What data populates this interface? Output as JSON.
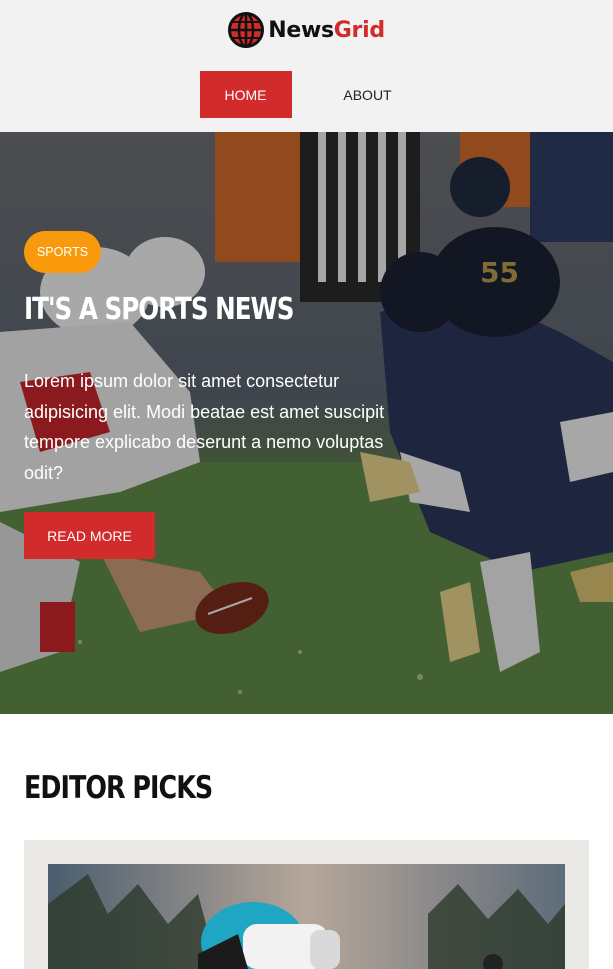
{
  "brand": {
    "name_part1": "News",
    "name_part2": "Grid",
    "accent_color": "#d22b2b",
    "logo_icon": "globe-icon"
  },
  "nav": {
    "items": [
      {
        "label": "HOME",
        "active": true
      },
      {
        "label": "ABOUT",
        "active": false
      }
    ]
  },
  "hero": {
    "category": "SPORTS",
    "title": "IT'S A SPORTS NEWS",
    "excerpt": "Lorem ipsum dolor sit amet consectetur adipisicing elit. Modi beatae est amet suscipit tempore explicabo deserunt a nemo voluptas odit?",
    "cta": "READ MORE",
    "badge_color": "#f99a0d"
  },
  "editor_picks": {
    "title": "EDITOR PICKS"
  }
}
